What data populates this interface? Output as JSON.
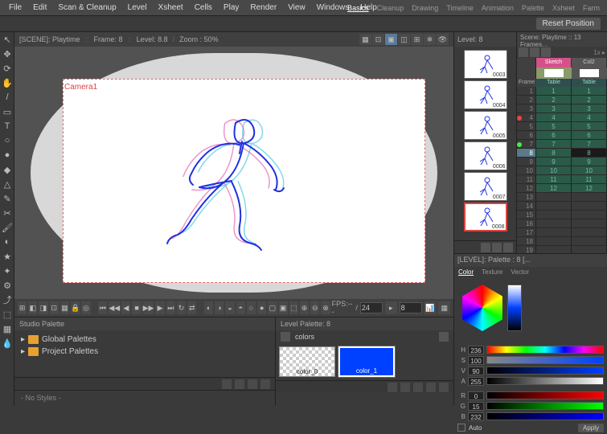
{
  "menu": [
    "File",
    "Edit",
    "Scan & Cleanup",
    "Level",
    "Xsheet",
    "Cells",
    "Play",
    "Render",
    "View",
    "Windows",
    "Help"
  ],
  "workspace_tabs": [
    "Basics",
    "Cleanup",
    "Drawing",
    "Timeline",
    "Animation",
    "Palette",
    "Xsheet",
    "Farm"
  ],
  "workspace_active": "Basics",
  "reset_btn": "Reset Position",
  "canvas_header": {
    "scene": "[SCENE]: Playtime",
    "frame": "Frame: 8",
    "level": "Level: 8.8",
    "zoom": "Zoom : 50%"
  },
  "camera_label": "Camera1",
  "playback": {
    "controls": [
      "⏮",
      "◀◀",
      "◀",
      "■",
      "▶▶",
      "▶",
      "⏭",
      "↻",
      "⇄"
    ],
    "fps_label": "FPS:---",
    "fps_input": "24",
    "frame_input": "8"
  },
  "thumbs": {
    "header": "Level:  8",
    "frames": [
      "0003",
      "0004",
      "0005",
      "0006",
      "0007",
      "0008"
    ],
    "selected": "0008"
  },
  "xsheet": {
    "header": "Scene: Playtime   ::   13 Frames…",
    "columns": [
      "Sketch",
      "Col2"
    ],
    "sub": [
      "Table",
      "Table"
    ],
    "frame_label": "Frame",
    "current": 8,
    "rows": 40,
    "filled_to": 12,
    "col2_fill_to": 12,
    "markers": {
      "red": 4,
      "green": 7
    }
  },
  "studio_palette": {
    "title": "Studio Palette",
    "items": [
      "Global Palettes",
      "Project Palettes"
    ],
    "no_styles": "- No Styles -"
  },
  "level_palette": {
    "title": "Level Palette: 8",
    "tab": "colors",
    "swatches": [
      {
        "name": "color_0",
        "type": "checker"
      },
      {
        "name": "color_1",
        "type": "blue"
      }
    ]
  },
  "color_panel": {
    "title": "[LEVEL]: Palette : 8 [...",
    "tabs": [
      "Color",
      "Texture",
      "Vector"
    ],
    "active": "Color",
    "sliders": [
      {
        "l": "H",
        "v": "236",
        "cls": "rainbow"
      },
      {
        "l": "S",
        "v": "100",
        "cls": "satbar"
      },
      {
        "l": "V",
        "v": "90",
        "cls": "valbar"
      },
      {
        "l": "A",
        "v": "255",
        "cls": "alphabar"
      },
      {
        "l": "R",
        "v": "0",
        "cls": "rbar"
      },
      {
        "l": "G",
        "v": "15",
        "cls": "gbar"
      },
      {
        "l": "B",
        "v": "232",
        "cls": "bbar"
      }
    ],
    "auto": "Auto",
    "apply": "Apply"
  },
  "tools": [
    "↖",
    "✥",
    "⟳",
    "✋",
    "/",
    "▭",
    "T",
    "○",
    "●",
    "◆",
    "△",
    "✎",
    "✂",
    "🖌",
    "◐",
    "★",
    "✦",
    "⚙",
    "⤴",
    "⬚",
    "▦",
    "💧"
  ]
}
